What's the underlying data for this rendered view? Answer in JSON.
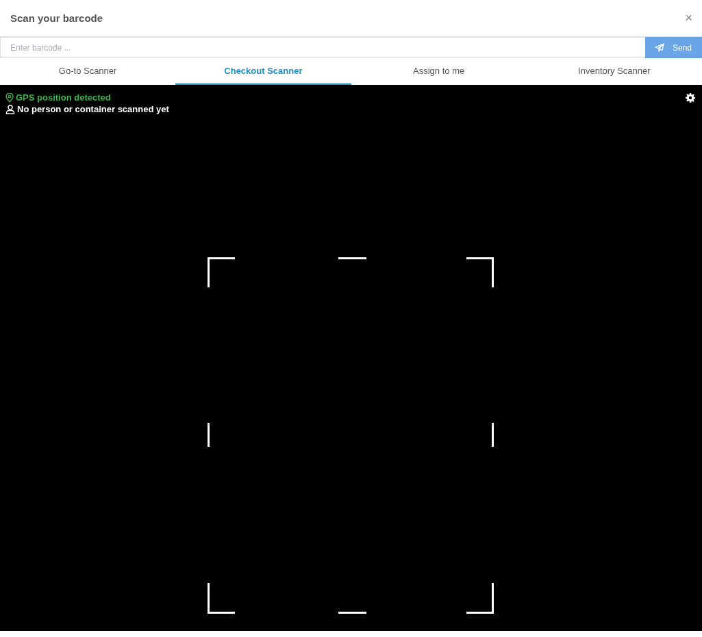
{
  "window": {
    "title": "Scan your barcode",
    "close": "×"
  },
  "barcode_field": {
    "placeholder": "Enter barcode ..."
  },
  "send_button": {
    "label": "Send"
  },
  "tabs": [
    {
      "label": "Go-to Scanner",
      "selected": false
    },
    {
      "label": "Checkout Scanner",
      "selected": true
    },
    {
      "label": "Assign to me",
      "selected": false
    },
    {
      "label": "Inventory Scanner",
      "selected": false
    }
  ],
  "scanner": {
    "gps_status": "GPS position detected",
    "scan_status": "No person or container scanned yet"
  }
}
